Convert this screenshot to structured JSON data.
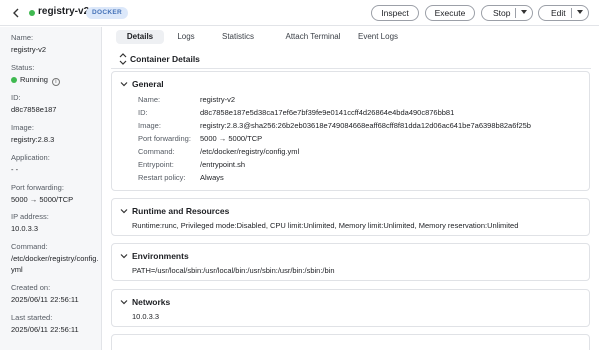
{
  "header": {
    "title": "registry-v2",
    "badge": "DOCKER",
    "buttons": {
      "inspect": "Inspect",
      "execute": "Execute",
      "stop": "Stop",
      "edit": "Edit"
    }
  },
  "sidebar": {
    "name_label": "Name:",
    "name_value": "registry-v2",
    "status_label": "Status:",
    "status_value": "Running",
    "id_label": "ID:",
    "id_value": "d8c7858e187",
    "image_label": "Image:",
    "image_value": "registry:2.8.3",
    "application_label": "Application:",
    "application_value": "- -",
    "port_label": "Port forwarding:",
    "port_value": "5000 → 5000/TCP",
    "ip_label": "IP address:",
    "ip_value": "10.0.3.3",
    "command_label": "Command:",
    "command_value": "/etc/docker/registry/config.yml",
    "created_label": "Created on:",
    "created_value": "2025/06/11 22:56:11",
    "started_label": "Last started:",
    "started_value": "2025/06/11 22:56:11"
  },
  "tabs": [
    "Details",
    "Logs",
    "Statistics",
    "Attach Terminal",
    "Event Logs"
  ],
  "container_details": {
    "title": "Container Details",
    "general": {
      "title": "General",
      "rows": [
        {
          "k": "Name:",
          "v": "registry-v2"
        },
        {
          "k": "ID:",
          "v": "d8c7858e187e5d38ca17ef6e7bf39fe9e0141ccff4d26864e4bda490c876bb81"
        },
        {
          "k": "Image:",
          "v": "registry:2.8.3@sha256:26b2eb03618e749084668eaff68cff8f81dda12d06ac641be7a6398b82a6f25b"
        },
        {
          "k": "Port forwarding:",
          "v": "5000 → 5000/TCP"
        },
        {
          "k": "Command:",
          "v": "/etc/docker/registry/config.yml"
        },
        {
          "k": "Entrypoint:",
          "v": "/entrypoint.sh"
        },
        {
          "k": "Restart policy:",
          "v": "Always"
        }
      ]
    },
    "runtime": {
      "title": "Runtime and Resources",
      "text": "Runtime:runc, Privileged mode:Disabled, CPU limit:Unlimited, Memory limit:Unlimited, Memory reservation:Unlimited"
    },
    "environments": {
      "title": "Environments",
      "text": "PATH=/usr/local/sbin:/usr/local/bin:/usr/sbin:/usr/bin:/sbin:/bin"
    },
    "networks": {
      "title": "Networks",
      "text": "10.0.3.3"
    }
  },
  "colors": {
    "running": "#3fb950",
    "badge_bg": "#dce8fa",
    "badge_text": "#4472b8"
  }
}
